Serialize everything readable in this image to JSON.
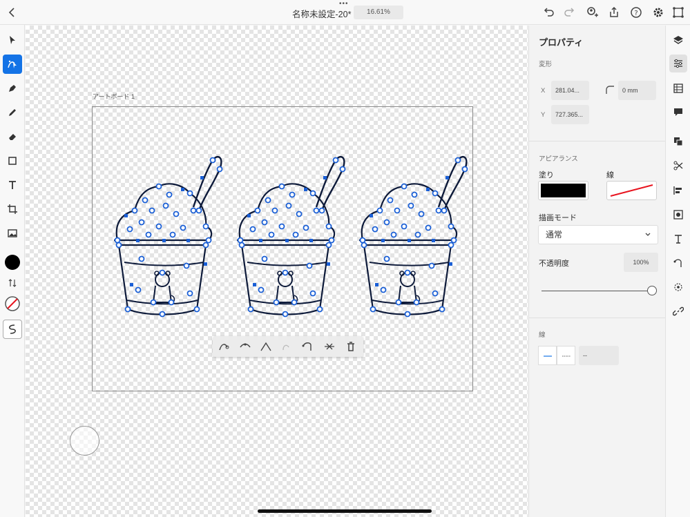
{
  "header": {
    "doc_title": "名称未設定-20*",
    "zoom": "16.61%",
    "more_dots": "•••"
  },
  "canvas": {
    "artboard_label": "アートボード 1"
  },
  "panel": {
    "title": "プロパティ",
    "transform": {
      "section_label": "変形",
      "x_label": "X",
      "x_value": "281.04...",
      "y_label": "Y",
      "y_value": "727.365...",
      "corner_value": "0 mm"
    },
    "appearance": {
      "section_label": "アピアランス",
      "fill_label": "塗り",
      "stroke_label": "線",
      "fill_color": "#000000",
      "stroke_color": "#e8141f",
      "blend_label": "描画モード",
      "blend_value": "通常",
      "opacity_label": "不透明度",
      "opacity_value": "100%",
      "opacity_level": 1.0
    },
    "stroke": {
      "section_label": "線",
      "width_value": "--"
    }
  },
  "colors": {
    "accent": "#1473e6",
    "path": "#1a5fd6",
    "artwork": "#0d1a3a"
  }
}
